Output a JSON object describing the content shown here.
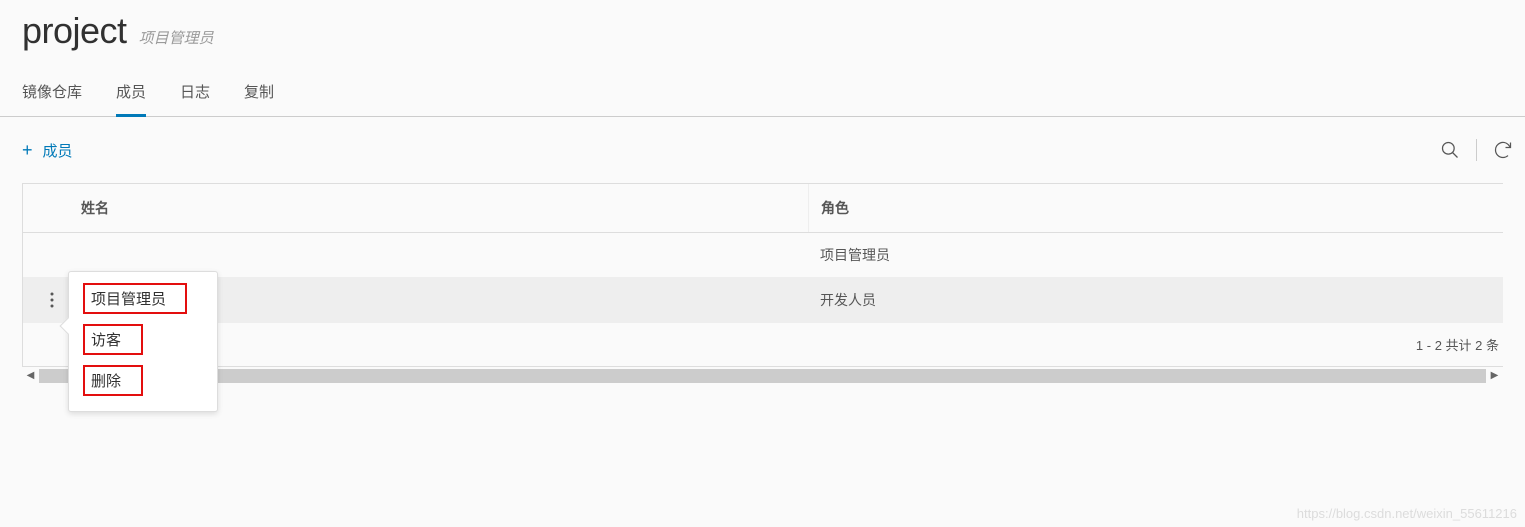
{
  "header": {
    "title": "project",
    "subtitle": "项目管理员"
  },
  "tabs": [
    {
      "label": "镜像仓库",
      "active": false
    },
    {
      "label": "成员",
      "active": true
    },
    {
      "label": "日志",
      "active": false
    },
    {
      "label": "复制",
      "active": false
    }
  ],
  "actions": {
    "add_label": "成员"
  },
  "table": {
    "columns": {
      "name": "姓名",
      "role": "角色"
    },
    "rows": [
      {
        "name": "",
        "role": "项目管理员",
        "selected": false,
        "show_actions": false
      },
      {
        "name": "",
        "role": "开发人员",
        "selected": true,
        "show_actions": true
      }
    ],
    "footer": "1 - 2 共计 2 条"
  },
  "menu": {
    "items": [
      {
        "label": "项目管理员",
        "wide": true
      },
      {
        "label": "访客",
        "wide": false
      },
      {
        "label": "删除",
        "wide": false
      }
    ]
  },
  "watermark": "https://blog.csdn.net/weixin_55611216"
}
